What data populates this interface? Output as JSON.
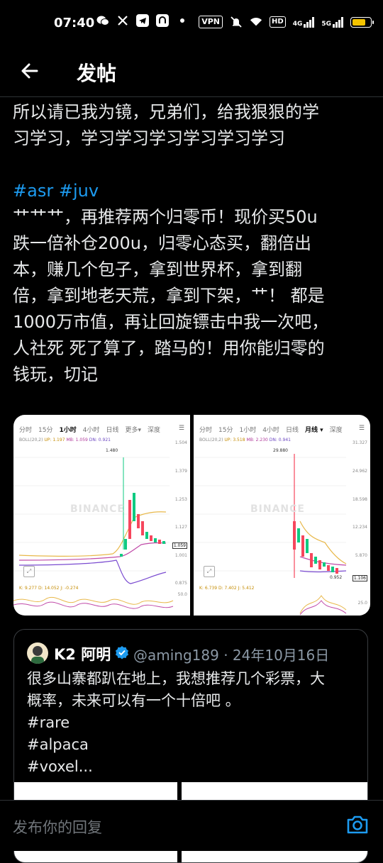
{
  "status_bar": {
    "time": "07:40",
    "vpn": "VPN",
    "hd": "HD",
    "network_4g": "4G",
    "network_5g": "5G",
    "battery_level": 0.8,
    "battery_color": "#f5c400"
  },
  "header": {
    "title": "发帖"
  },
  "post": {
    "lines_top": [
      "所以请已我为镜，兄弟们，给我狠狠的学",
      "习学习，学习学习学习学习学习学习"
    ],
    "hashtags": [
      "#asr",
      "#juv"
    ],
    "lines_body": [
      "艹艹艹，再推荐两个归零币！现价买50u",
      "跌一倍补仓200u，归零心态买，翻倍出",
      "本，赚几个包子，拿到世界杯，拿到翻",
      "倍，拿到地老天荒，拿到下架，艹！ 都是",
      "1000万市值，再让回旋镖击中我一次吧，",
      "人社死 死了算了，踏马的！用你能归零的",
      "钱玩，切记"
    ]
  },
  "charts": [
    {
      "tabs": [
        "分时",
        "15分",
        "1小时",
        "4小时",
        "日线",
        "更多▾",
        "深度"
      ],
      "active_tab": "1小时",
      "boll": "BOLL(20,2)",
      "up": "UP: 1.197",
      "mb": "MB: 1.059",
      "dn": "DN: 0.921",
      "high_label": "1.480",
      "axis": [
        "1.504",
        "1.379",
        "1.253",
        "1.127",
        "1.001",
        "0.875",
        "50.0"
      ],
      "price": "1.059",
      "kdj": "K: 9.277   D: 14.052   J: -0.274",
      "watermark": "BINANCE"
    },
    {
      "tabs": [
        "分时",
        "15分",
        "1小时",
        "4小时",
        "日线",
        "月线 ▾",
        "深度"
      ],
      "active_tab": "月线 ▾",
      "boll": "BOLL(20,2)",
      "up": "UP: 3.518",
      "mb": "MB: 2.230",
      "dn": "DN: 0.941",
      "high_label": "29.880",
      "axis": [
        "31.327",
        "24.962",
        "18.598",
        "12.234",
        "5.870",
        "25.0"
      ],
      "price": "1.106",
      "low_label": "0.952",
      "kdj": "K: 6.739   D: 7.402   J: 5.412",
      "watermark": "BINANCE"
    }
  ],
  "quote": {
    "name": "K2 阿明",
    "handle_date": "@aming189 · 24年10月16日",
    "lines": [
      "很多山寨都趴在地上，我想推荐几个彩票，大",
      "概率，未来可以有一个十倍吧 。",
      "#rare",
      "#alpaca",
      " #voxel..."
    ]
  },
  "reply": {
    "placeholder": "发布你的回复"
  },
  "colors": {
    "background": "#000000",
    "text": "#e7e9ea",
    "link": "#1d9bf0",
    "muted": "#71767b",
    "verified": "#1d9bf0"
  }
}
